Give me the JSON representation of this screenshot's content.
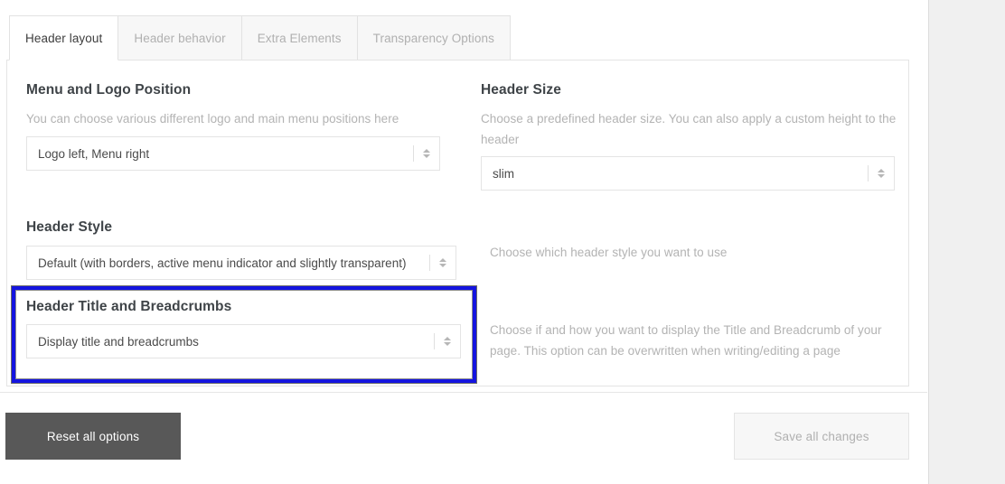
{
  "tabs": [
    {
      "label": "Header layout",
      "active": true
    },
    {
      "label": "Header behavior",
      "active": false
    },
    {
      "label": "Extra Elements",
      "active": false
    },
    {
      "label": "Transparency Options",
      "active": false
    }
  ],
  "sections": {
    "menu_logo": {
      "title": "Menu and Logo Position",
      "description": "You can choose various different logo and main menu positions here",
      "select_value": "Logo left, Menu right"
    },
    "header_size": {
      "title": "Header Size",
      "description": "Choose a predefined header size. You can also apply a custom height to the header",
      "select_value": "slim"
    },
    "header_style": {
      "title": "Header Style",
      "select_value": "Default (with borders, active menu indicator and slightly transparent)",
      "description": "Choose which header style you want to use"
    },
    "header_title_breadcrumbs": {
      "title": "Header Title and Breadcrumbs",
      "select_value": "Display title and breadcrumbs",
      "description": "Choose if and how you want to display the Title and Breadcrumb of your page. This option can be overwritten when writing/editing a page"
    }
  },
  "footer": {
    "reset_label": "Reset all options",
    "save_label": "Save all changes"
  },
  "colors": {
    "highlight_border": "#1414e0",
    "reset_button_bg": "#585858",
    "tab_active_text": "#3d3d3d",
    "tab_inactive_text": "#b0b0b0",
    "description_text": "#b3b3b3"
  }
}
